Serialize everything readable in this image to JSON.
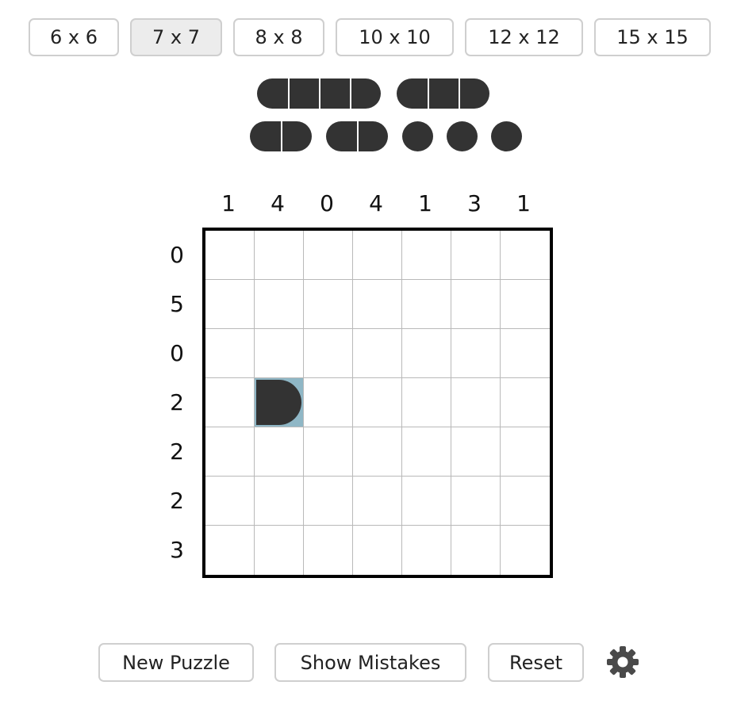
{
  "size_buttons": [
    {
      "label": "6 x 6",
      "active": false
    },
    {
      "label": "7 x 7",
      "active": true
    },
    {
      "label": "8 x 8",
      "active": false
    },
    {
      "label": "10 x 10",
      "active": false
    },
    {
      "label": "12 x 12",
      "active": false
    },
    {
      "label": "15 x 15",
      "active": false
    }
  ],
  "fleet": [
    {
      "name": "battleship",
      "length": 4
    },
    {
      "name": "cruiser",
      "length": 3
    },
    {
      "name": "destroyer",
      "length": 2
    },
    {
      "name": "destroyer",
      "length": 2
    },
    {
      "name": "submarine",
      "length": 1
    },
    {
      "name": "submarine",
      "length": 1
    },
    {
      "name": "submarine",
      "length": 1
    }
  ],
  "board": {
    "size": 7,
    "column_clues": [
      "1",
      "4",
      "0",
      "4",
      "1",
      "3",
      "1"
    ],
    "row_clues": [
      "0",
      "5",
      "0",
      "2",
      "2",
      "2",
      "3"
    ],
    "placed_pieces": [
      {
        "row": 3,
        "col": 1,
        "shape": "end-right",
        "highlighted": true
      }
    ]
  },
  "controls": {
    "new_puzzle": "New Puzzle",
    "show_mistakes": "Show Mistakes",
    "reset": "Reset",
    "settings_icon": "gear-icon"
  },
  "colors": {
    "ship": "#333333",
    "highlight": "#8fb7c6",
    "grid_border": "#000000",
    "grid_line": "#b9b9b9",
    "active_button": "#ececec"
  }
}
